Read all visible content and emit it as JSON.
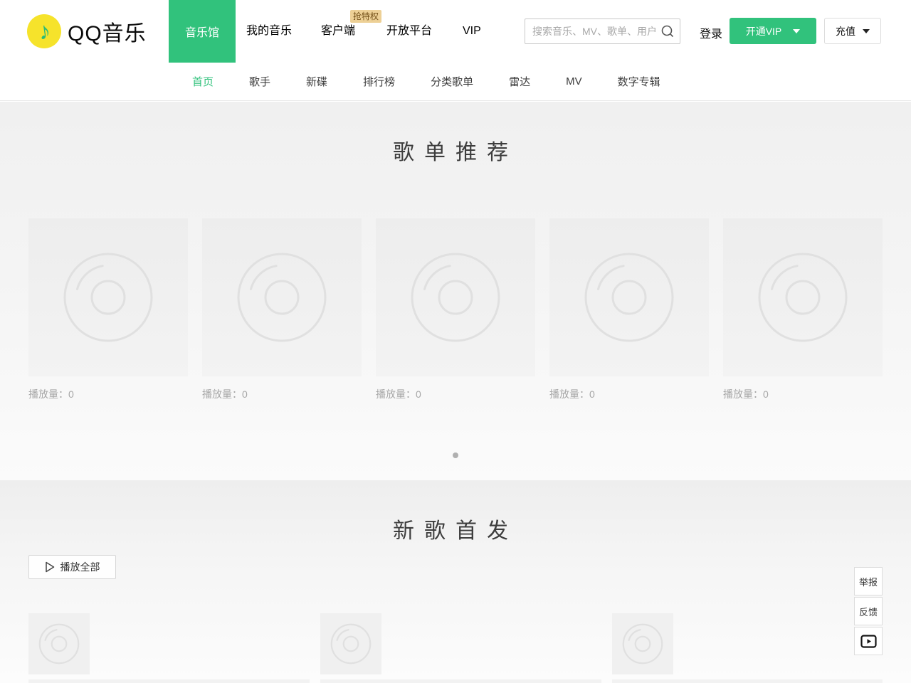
{
  "colors": {
    "accent": "#31c27c",
    "logo_yellow": "#f6e32b",
    "badge_bg": "#edd096"
  },
  "brand": {
    "logo_text": "QQ音乐"
  },
  "header": {
    "nav": [
      {
        "label": "音乐馆",
        "active": true
      },
      {
        "label": "我的音乐"
      },
      {
        "label": "客户端",
        "badge": "抢特权"
      },
      {
        "label": "开放平台"
      },
      {
        "label": "VIP"
      }
    ],
    "search": {
      "placeholder": "搜索音乐、MV、歌单、用户",
      "value": ""
    },
    "login_label": "登录",
    "vip_button_label": "开通VIP",
    "recharge_button_label": "充值"
  },
  "subnav": {
    "items": [
      {
        "label": "首页",
        "active": true
      },
      {
        "label": "歌手"
      },
      {
        "label": "新碟"
      },
      {
        "label": "排行榜"
      },
      {
        "label": "分类歌单"
      },
      {
        "label": "雷达"
      },
      {
        "label": "MV"
      },
      {
        "label": "数字专辑"
      }
    ]
  },
  "sections": {
    "playlist": {
      "title": "歌单推荐",
      "cards": [
        {
          "playcount": "播放量：0"
        },
        {
          "playcount": "播放量：0"
        },
        {
          "playcount": "播放量：0"
        },
        {
          "playcount": "播放量：0"
        },
        {
          "playcount": "播放量：0"
        }
      ],
      "carousel_pages": 1
    },
    "newsong": {
      "title": "新歌首发",
      "play_all_label": "播放全部",
      "visible_thumbs": 3
    }
  },
  "floating": {
    "report_label": "举报",
    "feedback_label": "反馈",
    "video_icon": "video-play-icon"
  },
  "icons": {
    "logo_note": "music-note-icon",
    "search": "search-icon",
    "cd_placeholder": "cd-disc-icon",
    "play_outline": "play-outline-icon",
    "caret": "chevron-down-icon"
  }
}
